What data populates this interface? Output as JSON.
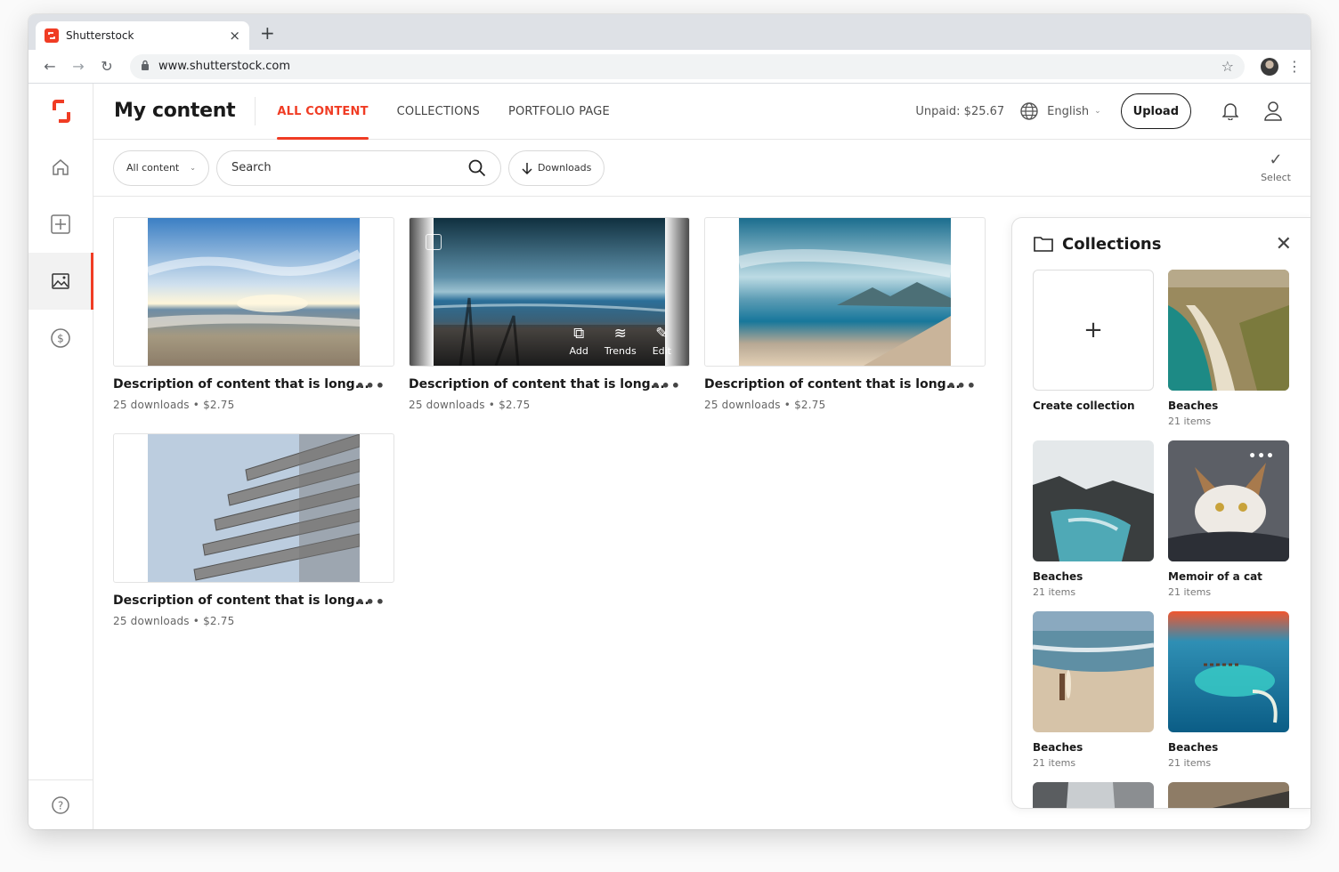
{
  "browser": {
    "tab_title": "Shutterstock",
    "tab_close": "×",
    "new_tab": "+",
    "url": "www.shutterstock.com",
    "back": "←",
    "forward": "→",
    "reload": "↻",
    "star": "☆",
    "menu": "⋮",
    "lock": "🔒"
  },
  "header": {
    "title": "My content",
    "tabs": [
      {
        "label": "ALL CONTENT",
        "active": true
      },
      {
        "label": "COLLECTIONS",
        "active": false
      },
      {
        "label": "PORTFOLIO PAGE",
        "active": false
      }
    ],
    "unpaid": "Unpaid: $25.67",
    "language": "English",
    "upload": "Upload"
  },
  "filters": {
    "type": "All content",
    "search_placeholder": "Search",
    "sort": "Downloads",
    "select": "Select"
  },
  "content": [
    {
      "description": "Description of content that is long...",
      "stats": "25 downloads • $2.75",
      "more": "•••"
    },
    {
      "description": "Description of content that is long...",
      "stats": "25 downloads • $2.75",
      "more": "•••",
      "actions": [
        {
          "label": "Add",
          "icon": "add-collection-icon"
        },
        {
          "label": "Trends",
          "icon": "trends-icon"
        },
        {
          "label": "Edit",
          "icon": "edit-icon"
        }
      ]
    },
    {
      "description": "Description of content that is long...",
      "stats": "25 downloads • $2.75",
      "more": "•••"
    },
    {
      "description": "Description of content that is long...",
      "stats": "25 downloads • $2.75",
      "more": "•••"
    }
  ],
  "collections": {
    "title": "Collections",
    "create_label": "Create collection",
    "items": [
      {
        "name": "Beaches",
        "count": "21 items"
      },
      {
        "name": "Beaches",
        "count": "21 items"
      },
      {
        "name": "Memoir of a cat",
        "count": "21 items"
      },
      {
        "name": "Beaches",
        "count": "21 items"
      },
      {
        "name": "Beaches",
        "count": "21 items"
      }
    ]
  },
  "colors": {
    "accent": "#f03c24",
    "text": "#1a1a1a",
    "muted": "#666666"
  }
}
